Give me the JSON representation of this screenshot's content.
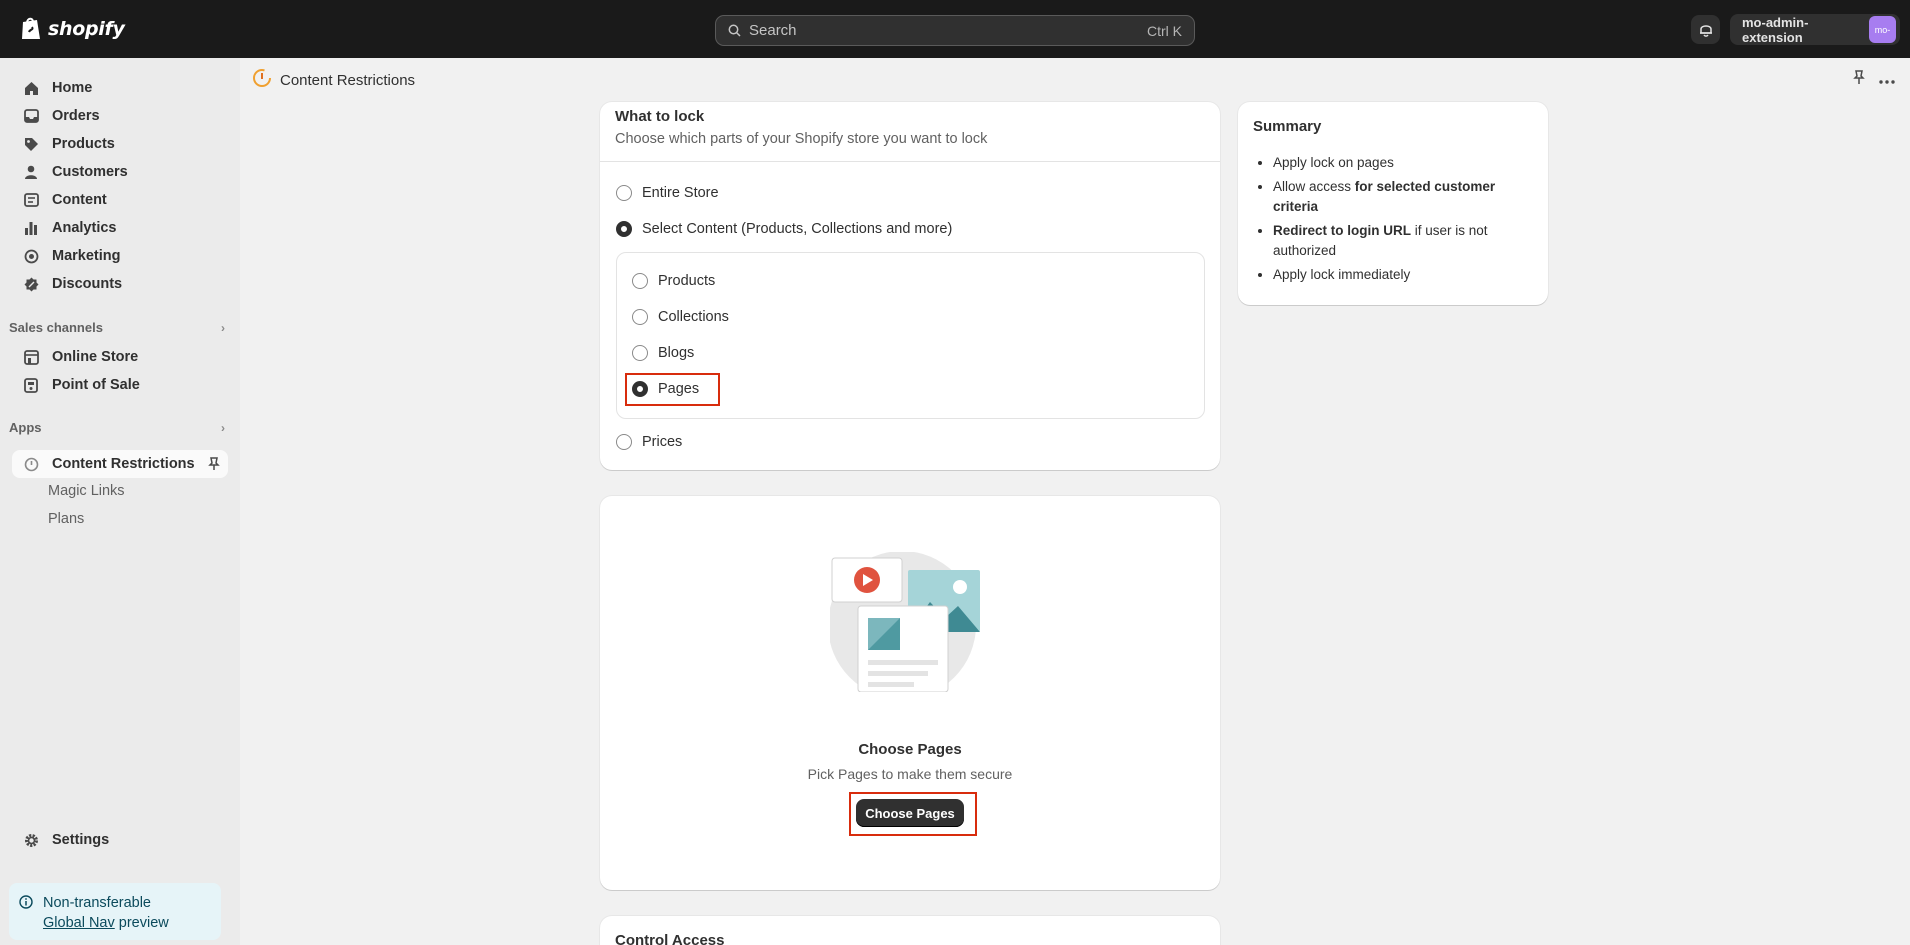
{
  "topbar": {
    "brand": "shopify",
    "search_placeholder": "Search",
    "search_shortcut": "Ctrl K",
    "account_name": "mo-admin-extension",
    "avatar_initials": "mo-"
  },
  "sidebar": {
    "items": [
      {
        "label": "Home",
        "icon": "home-icon"
      },
      {
        "label": "Orders",
        "icon": "orders-icon"
      },
      {
        "label": "Products",
        "icon": "tag-icon"
      },
      {
        "label": "Customers",
        "icon": "person-icon"
      },
      {
        "label": "Content",
        "icon": "content-icon"
      },
      {
        "label": "Analytics",
        "icon": "bar-chart-icon"
      },
      {
        "label": "Marketing",
        "icon": "target-icon"
      },
      {
        "label": "Discounts",
        "icon": "discount-icon"
      }
    ],
    "sales_channels_label": "Sales channels",
    "sales_channels": [
      {
        "label": "Online Store",
        "icon": "store-icon"
      },
      {
        "label": "Point of Sale",
        "icon": "pos-icon"
      }
    ],
    "apps_label": "Apps",
    "app_active": "Content Restrictions",
    "app_subitems": [
      "Magic Links",
      "Plans"
    ],
    "settings_label": "Settings",
    "notice_line1": "Non-transferable",
    "notice_link": "Global Nav",
    "notice_rest": " preview"
  },
  "page": {
    "title": "Content Restrictions"
  },
  "lock": {
    "title": "What to lock",
    "subtitle": "Choose which parts of your Shopify store you want to lock",
    "options": [
      "Entire Store",
      "Select Content (Products, Collections and more)"
    ],
    "sub_options": [
      "Products",
      "Collections",
      "Blogs",
      "Pages"
    ],
    "selected_option": "Select Content (Products, Collections and more)",
    "selected_sub_option": "Pages",
    "extra_option": "Prices"
  },
  "choose": {
    "title": "Choose Pages",
    "subtitle": "Pick Pages to make them secure",
    "button": "Choose Pages"
  },
  "control": {
    "title": "Control Access"
  },
  "summary": {
    "title": "Summary",
    "item1": "Apply lock on pages",
    "item2_a": "Allow access ",
    "item2_b": "for selected customer criteria",
    "item3_a": "Redirect to login URL",
    "item3_b": " if user is not authorized",
    "item4": "Apply lock immediately"
  },
  "colors": {
    "topbar": "#1a1a1a",
    "highlight": "#d82c0d",
    "avatar": "#a77df0",
    "notice_bg": "#e6f4f8"
  }
}
